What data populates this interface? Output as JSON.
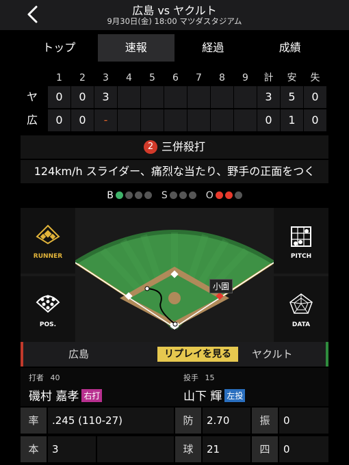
{
  "header": {
    "title": "広島 vs ヤクルト",
    "subtitle": "9月30日(金) 18:00 マツダスタジアム"
  },
  "tabs": [
    {
      "label": "トップ"
    },
    {
      "label": "速報",
      "active": true
    },
    {
      "label": "経過"
    },
    {
      "label": "成績"
    }
  ],
  "scoreboard": {
    "innings": [
      "1",
      "2",
      "3",
      "4",
      "5",
      "6",
      "7",
      "8",
      "9"
    ],
    "totals_headers": [
      "計",
      "安",
      "失"
    ],
    "teams": [
      {
        "abbr": "ヤ",
        "innings": [
          "0",
          "0",
          "3",
          "",
          "",
          "",
          "",
          "",
          ""
        ],
        "totals": [
          "3",
          "5",
          "0"
        ]
      },
      {
        "abbr": "広",
        "innings": [
          "0",
          "0",
          "-",
          "",
          "",
          "",
          "",
          "",
          ""
        ],
        "totals": [
          "0",
          "1",
          "0"
        ]
      }
    ]
  },
  "play": {
    "outs_badge": "2",
    "result": "三併殺打",
    "description": "124km/h スライダー、痛烈な当たり、野手の正面をつく"
  },
  "count": {
    "ball_label": "B",
    "balls": 1,
    "balls_max": 4,
    "strike_label": "S",
    "strikes": 0,
    "strikes_max": 3,
    "out_label": "O",
    "outs": 2,
    "outs_max": 3
  },
  "field": {
    "runner_label": "RUNNER",
    "pos_label": "POS.",
    "pitch_label": "PITCH",
    "data_label": "DATA",
    "fielder_tag": "小園"
  },
  "teams_bar": {
    "home": "広島",
    "replay_label": "リプレイを見る",
    "away": "ヤクルト"
  },
  "batter": {
    "role": "打者",
    "number": "40",
    "name": "磯村 嘉孝",
    "hand": "右打"
  },
  "pitcher": {
    "role": "投手",
    "number": "15",
    "name": "山下 輝",
    "hand": "左投"
  },
  "batter_stats": [
    {
      "label": "率",
      "value": ".245 (110-27)"
    },
    {
      "label": "本",
      "value": "3"
    }
  ],
  "pitcher_stats": [
    {
      "label": "防",
      "value": "2.70"
    },
    {
      "label": "振",
      "value": "0"
    },
    {
      "label": "球",
      "value": "21"
    },
    {
      "label": "四",
      "value": "0"
    }
  ],
  "colors": {
    "tag_batter": "#b8308f",
    "tag_pitcher": "#2a6fbf",
    "replay": "#e6c84f",
    "ball": "#3fb36a",
    "out": "#e8392c"
  }
}
